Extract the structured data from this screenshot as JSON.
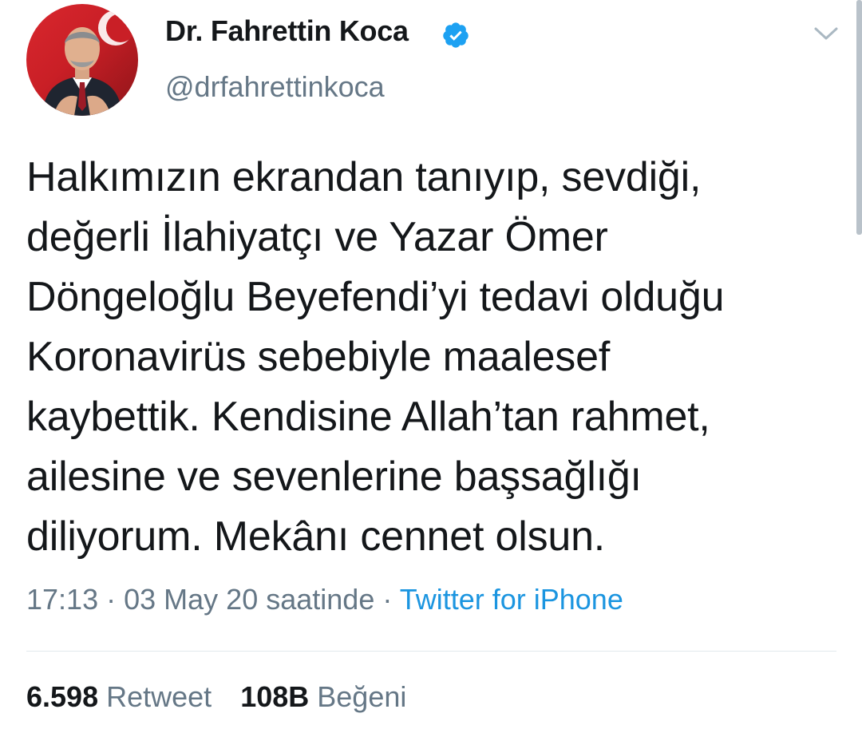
{
  "author": {
    "display_name": "Dr. Fahrettin Koca",
    "handle": "@drfahrettinkoca",
    "verified": true,
    "avatar_icon": "profile-photo",
    "avatar_bg": "#d9272e"
  },
  "tweet": {
    "lines": [
      "Halkımızın ekrandan tanıyıp, sevdiği,",
      "değerli İlahiyatçı ve Yazar Ömer",
      "Döngeloğlu Beyefendi’yi tedavi olduğu",
      "Koronavirüs sebebiyle maalesef",
      "kaybettik. Kendisine Allah’tan rahmet,",
      "ailesine ve sevenlerine başsağlığı",
      "diliyorum. Mekânı cennet olsun."
    ],
    "time": "17:13",
    "separator": "·",
    "date": "03 May 20 saatinde",
    "source": "Twitter for iPhone"
  },
  "stats": {
    "retweets_count": "6.598",
    "retweets_label": "Retweet",
    "likes_count": "108B",
    "likes_label": "Beğeni"
  },
  "icons": {
    "verified": "verified-badge-icon",
    "menu": "chevron-down-icon"
  },
  "colors": {
    "text": "#14171a",
    "secondary": "#657786",
    "link": "#1b95e0",
    "verified": "#1da1f2",
    "divider": "#e1e8ed"
  }
}
